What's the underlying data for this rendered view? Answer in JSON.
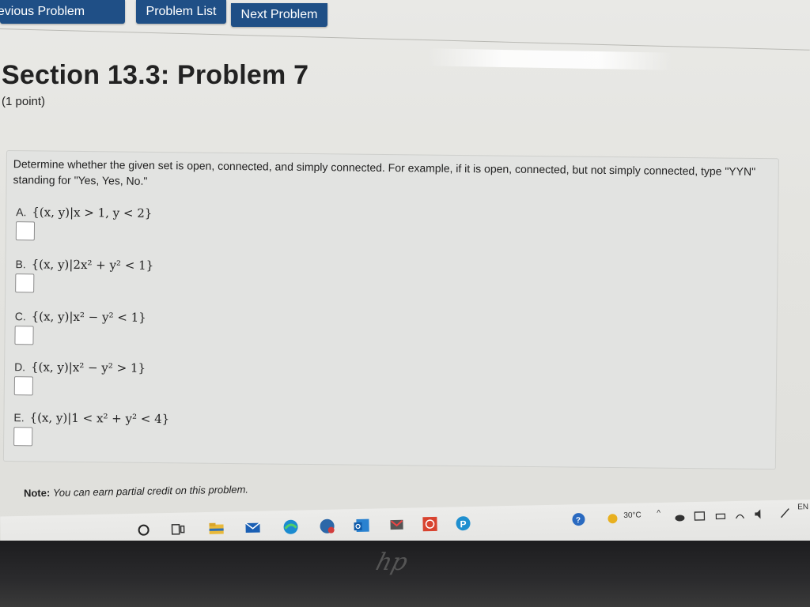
{
  "nav": {
    "previous_label": "Previous Problem",
    "list_label": "Problem List",
    "next_label": "Next Problem"
  },
  "header": {
    "title": "Section 13.3: Problem 7",
    "points": "(1 point)"
  },
  "problem": {
    "instructions": "Determine whether the given set is open, connected, and simply connected. For example, if it is open, connected, but not simply connected, type \"YYN\" standing for \"Yes, Yes, No.\"",
    "choices": [
      {
        "letter": "A.",
        "set": "{(x, y)|x > 1, y < 2}",
        "value": ""
      },
      {
        "letter": "B.",
        "set": "{(x, y)|2x² + y² < 1}",
        "value": ""
      },
      {
        "letter": "C.",
        "set": "{(x, y)|x² − y² < 1}",
        "value": ""
      },
      {
        "letter": "D.",
        "set": "{(x, y)|x² − y² > 1}",
        "value": ""
      },
      {
        "letter": "E.",
        "set": "{(x, y)|1 < x² + y² < 4}",
        "value": ""
      }
    ]
  },
  "note": {
    "label": "Note:",
    "text": "You can earn partial credit on this problem."
  },
  "taskbar": {
    "icons": [
      "search-circle-icon",
      "task-view-icon",
      "file-explorer-icon",
      "mail-icon",
      "edge-icon",
      "chat-icon",
      "outlook-icon",
      "gmail-icon",
      "app-icon",
      "pinterest-icon"
    ],
    "temperature": "30°C",
    "language": "EN"
  },
  "device": {
    "logo": "hp"
  }
}
